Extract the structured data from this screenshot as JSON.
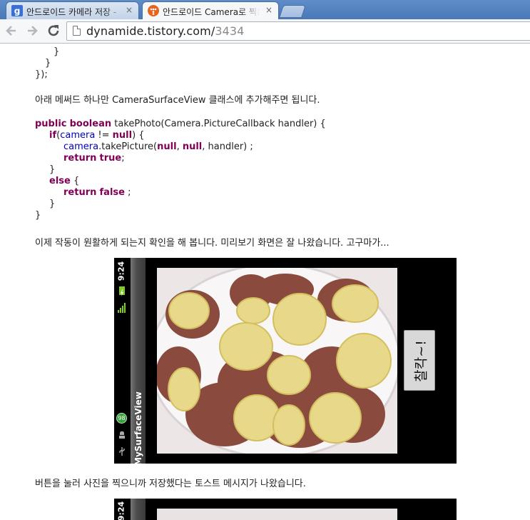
{
  "browser": {
    "tabs": [
      {
        "title": "안드로이드 카메라 저장 -",
        "close": "×",
        "favicon": "google-g-icon"
      },
      {
        "title": "안드로이드 Camera로 찍은",
        "close": "×",
        "favicon": "tistory-icon"
      }
    ],
    "url_host": "dynamide.tistory.com/",
    "url_path": "3434",
    "icons": [
      "back-arrow-icon",
      "forward-arrow-icon",
      "reload-icon",
      "page-icon"
    ]
  },
  "content": {
    "code1_lines": [
      "}",
      "}",
      "});"
    ],
    "paragraph1": "아래 메써드 하나만 CameraSurfaceView 클래스에 추가해주면 됩니다.",
    "code2": {
      "kw_public": "public",
      "kw_boolean": "boolean",
      "method_sig": " takePhoto(Camera.PictureCallback handler) {",
      "kw_if": "if",
      "if_open": "(",
      "fld_camera": "camera",
      "neq": " != ",
      "kw_null": "null",
      "if_close": ") {",
      "fld_camera2": "camera",
      "take_call": ".takePicture(",
      "kw_null2": "null",
      "comma1": ", ",
      "kw_null3": "null",
      "take_end": ", handler) ;",
      "kw_return": "return",
      "kw_true": "true",
      "semi1": ";",
      "close_if": "}",
      "kw_else": "else",
      "else_open": " {",
      "kw_return2": "return",
      "kw_false": "false",
      "semi2": " ;",
      "close_else": "}",
      "close_method": "}"
    },
    "paragraph2": "이제 작동이 원활하게 되는지 확인을 해 봅니다. 미리보기 화면은 잘 나왔습니다. 고구마가...",
    "screenshot1": {
      "status_time": "9:24",
      "app_title": "MySurfaceView",
      "notification_badge": "98",
      "shutter_label": "찰칵~!",
      "icons": [
        "signal-icon",
        "battery-icon",
        "android-icon",
        "usb-icon"
      ]
    },
    "paragraph3": "버튼을 눌러 사진을 찍으니까 저장했다는 토스트 메시지가 나왔습니다.",
    "screenshot2": {
      "status_time": "9:24"
    }
  },
  "colors": {
    "keyword": "#7f0055",
    "field": "#0000c0",
    "chrome_blue": "#4a78b8",
    "battery_green": "#7fcc28"
  }
}
